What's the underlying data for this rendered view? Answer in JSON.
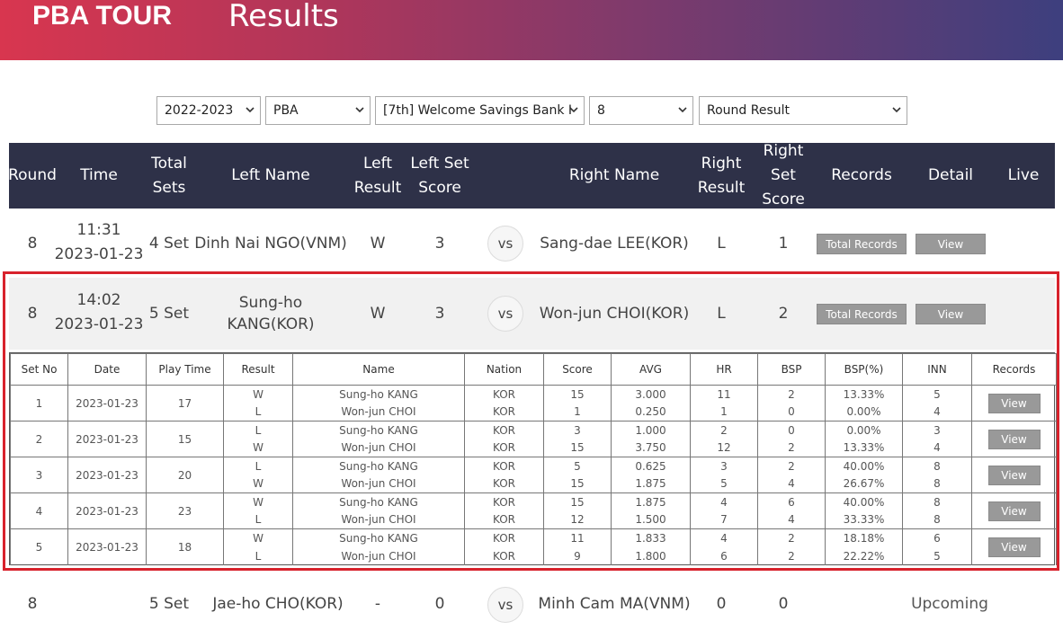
{
  "header": {
    "logo": "PBA TOUR",
    "title": "Results"
  },
  "filters": {
    "season": "2022-2023",
    "tour": "PBA",
    "event": "[7th] Welcome Savings Bank I",
    "round": "8",
    "view": "Round Result"
  },
  "table_headers": {
    "round": "Round",
    "time": "Time",
    "total_sets": "Total Sets",
    "left_name": "Left Name",
    "left_result": "Left Result",
    "left_set_score": "Left Set Score",
    "right_name": "Right Name",
    "right_result": "Right Result",
    "right_set_score": "Right Set Score",
    "records": "Records",
    "detail": "Detail",
    "live": "Live"
  },
  "matches": [
    {
      "round": "8",
      "time": "11:31",
      "date": "2023-01-23",
      "sets": "4 Set",
      "left": "Dinh Nai NGO(VNM)",
      "left_result": "W",
      "left_score": "3",
      "vs": "vs",
      "right": "Sang-dae LEE(KOR)",
      "right_result": "L",
      "right_score": "1",
      "records_btn": "Total Records",
      "detail_btn": "View"
    },
    {
      "round": "8",
      "time": "14:02",
      "date": "2023-01-23",
      "sets": "5 Set",
      "left": "Sung-ho KANG(KOR)",
      "left_result": "W",
      "left_score": "3",
      "vs": "vs",
      "right": "Won-jun CHOI(KOR)",
      "right_result": "L",
      "right_score": "2",
      "records_btn": "Total Records",
      "detail_btn": "View"
    },
    {
      "round": "8",
      "sets": "5 Set",
      "left": "Jae-ho CHO(KOR)",
      "left_result": "-",
      "left_score": "0",
      "vs": "vs",
      "right": "Minh Cam MA(VNM)",
      "right_result": "0",
      "right_score": "0",
      "status": "Upcoming"
    }
  ],
  "set_table": {
    "headers": [
      "Set No",
      "Date",
      "Play Time",
      "Result",
      "Name",
      "Nation",
      "Score",
      "AVG",
      "HR",
      "BSP",
      "BSP(%)",
      "INN",
      "Records"
    ],
    "view_label": "View",
    "sets": [
      {
        "no": "1",
        "date": "2023-01-23",
        "play_time": "17",
        "players": [
          {
            "result": "W",
            "name": "Sung-ho KANG",
            "nation": "KOR",
            "score": "15",
            "avg": "3.000",
            "hr": "11",
            "bsp": "2",
            "bsp_pct": "13.33%",
            "inn": "5"
          },
          {
            "result": "L",
            "name": "Won-jun CHOI",
            "nation": "KOR",
            "score": "1",
            "avg": "0.250",
            "hr": "1",
            "bsp": "0",
            "bsp_pct": "0.00%",
            "inn": "4"
          }
        ]
      },
      {
        "no": "2",
        "date": "2023-01-23",
        "play_time": "15",
        "players": [
          {
            "result": "L",
            "name": "Sung-ho KANG",
            "nation": "KOR",
            "score": "3",
            "avg": "1.000",
            "hr": "2",
            "bsp": "0",
            "bsp_pct": "0.00%",
            "inn": "3"
          },
          {
            "result": "W",
            "name": "Won-jun CHOI",
            "nation": "KOR",
            "score": "15",
            "avg": "3.750",
            "hr": "12",
            "bsp": "2",
            "bsp_pct": "13.33%",
            "inn": "4"
          }
        ]
      },
      {
        "no": "3",
        "date": "2023-01-23",
        "play_time": "20",
        "players": [
          {
            "result": "L",
            "name": "Sung-ho KANG",
            "nation": "KOR",
            "score": "5",
            "avg": "0.625",
            "hr": "3",
            "bsp": "2",
            "bsp_pct": "40.00%",
            "inn": "8"
          },
          {
            "result": "W",
            "name": "Won-jun CHOI",
            "nation": "KOR",
            "score": "15",
            "avg": "1.875",
            "hr": "5",
            "bsp": "4",
            "bsp_pct": "26.67%",
            "inn": "8"
          }
        ]
      },
      {
        "no": "4",
        "date": "2023-01-23",
        "play_time": "23",
        "players": [
          {
            "result": "W",
            "name": "Sung-ho KANG",
            "nation": "KOR",
            "score": "15",
            "avg": "1.875",
            "hr": "4",
            "bsp": "6",
            "bsp_pct": "40.00%",
            "inn": "8"
          },
          {
            "result": "L",
            "name": "Won-jun CHOI",
            "nation": "KOR",
            "score": "12",
            "avg": "1.500",
            "hr": "7",
            "bsp": "4",
            "bsp_pct": "33.33%",
            "inn": "8"
          }
        ]
      },
      {
        "no": "5",
        "date": "2023-01-23",
        "play_time": "18",
        "players": [
          {
            "result": "W",
            "name": "Sung-ho KANG",
            "nation": "KOR",
            "score": "11",
            "avg": "1.833",
            "hr": "4",
            "bsp": "2",
            "bsp_pct": "18.18%",
            "inn": "6"
          },
          {
            "result": "L",
            "name": "Won-jun CHOI",
            "nation": "KOR",
            "score": "9",
            "avg": "1.800",
            "hr": "6",
            "bsp": "2",
            "bsp_pct": "22.22%",
            "inn": "5"
          }
        ]
      }
    ]
  },
  "colors": {
    "header_bg": "#2e3148",
    "highlight": "#d8222c",
    "button_gray": "#999999"
  }
}
